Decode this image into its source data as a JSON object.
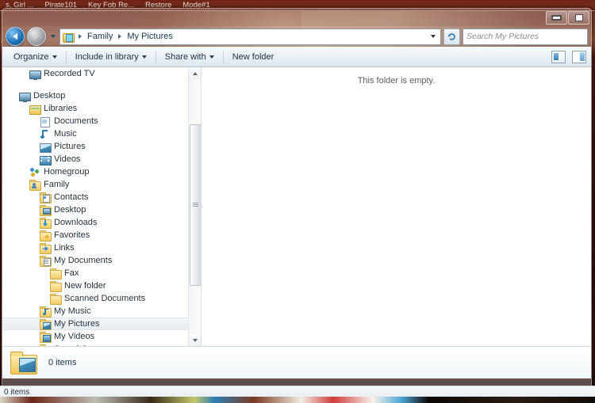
{
  "taskbar": {
    "items": [
      {
        "label": "s, Girl ..."
      },
      {
        "label": "Pirate101"
      },
      {
        "label": "Key Fob Re..."
      },
      {
        "label": "Restore"
      },
      {
        "label": "Mode#1"
      }
    ]
  },
  "window": {
    "title": "",
    "minimize_label": "Minimize",
    "restore_label": "Restore"
  },
  "address": {
    "back_label": "Back",
    "forward_label": "Forward",
    "history_label": "Recent pages",
    "breadcrumbs": [
      "Family",
      "My Pictures"
    ],
    "dropdown_label": "Previous locations",
    "refresh_label": "Refresh"
  },
  "search": {
    "placeholder": "Search My Pictures",
    "value": ""
  },
  "toolbar": {
    "organize_label": "Organize",
    "include_label": "Include in library",
    "share_label": "Share with",
    "new_folder_label": "New folder",
    "view_label": "Change your view",
    "view_dropdown_label": "View options",
    "preview_pane_label": "Show the preview pane"
  },
  "navigation": {
    "items": [
      {
        "label": "Recorded TV",
        "indent": 2,
        "icon": "monitor-icon",
        "selected": false
      },
      {
        "label": "",
        "indent": 0,
        "icon": "spacer",
        "selected": false
      },
      {
        "label": "Desktop",
        "indent": 1,
        "icon": "desktop-icon",
        "selected": false
      },
      {
        "label": "Libraries",
        "indent": 2,
        "icon": "library-icon",
        "selected": false
      },
      {
        "label": "Documents",
        "indent": 3,
        "icon": "documents-icon",
        "selected": false
      },
      {
        "label": "Music",
        "indent": 3,
        "icon": "music-icon",
        "selected": false
      },
      {
        "label": "Pictures",
        "indent": 3,
        "icon": "pictures-icon",
        "selected": false
      },
      {
        "label": "Videos",
        "indent": 3,
        "icon": "videos-icon",
        "selected": false
      },
      {
        "label": "Homegroup",
        "indent": 2,
        "icon": "homegroup-icon",
        "selected": false
      },
      {
        "label": "Family",
        "indent": 2,
        "icon": "user-folder-icon",
        "selected": false
      },
      {
        "label": "Contacts",
        "indent": 3,
        "icon": "contacts-icon",
        "selected": false
      },
      {
        "label": "Desktop",
        "indent": 3,
        "icon": "desktop-folder-icon",
        "selected": false
      },
      {
        "label": "Downloads",
        "indent": 3,
        "icon": "downloads-icon",
        "selected": false
      },
      {
        "label": "Favorites",
        "indent": 3,
        "icon": "favorites-icon",
        "selected": false
      },
      {
        "label": "Links",
        "indent": 3,
        "icon": "links-icon",
        "selected": false
      },
      {
        "label": "My Documents",
        "indent": 3,
        "icon": "my-documents-icon",
        "selected": false
      },
      {
        "label": "Fax",
        "indent": 4,
        "icon": "folder-icon",
        "selected": false
      },
      {
        "label": "New folder",
        "indent": 4,
        "icon": "folder-icon",
        "selected": false
      },
      {
        "label": "Scanned Documents",
        "indent": 4,
        "icon": "folder-icon",
        "selected": false
      },
      {
        "label": "My Music",
        "indent": 3,
        "icon": "my-music-icon",
        "selected": false
      },
      {
        "label": "My Pictures",
        "indent": 3,
        "icon": "my-pictures-icon",
        "selected": true
      },
      {
        "label": "My Videos",
        "indent": 3,
        "icon": "my-videos-icon",
        "selected": false
      },
      {
        "label": "Saved Games",
        "indent": 3,
        "icon": "saved-games-icon",
        "selected": false
      }
    ]
  },
  "file_pane": {
    "empty_message": "This folder is empty."
  },
  "details": {
    "item_count": "0 items"
  },
  "status": {
    "text": "0 items"
  },
  "colors": {
    "selection": "#eef3f7",
    "window_chrome": "#dde7ef",
    "taskbar": "#7d2c1c"
  }
}
